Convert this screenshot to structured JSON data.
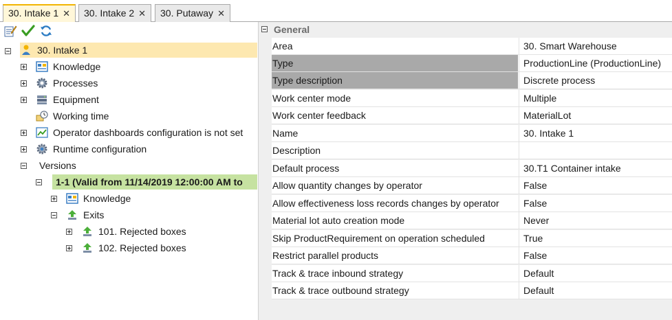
{
  "tabs": [
    {
      "label": "30. Intake 1",
      "close": "✕",
      "active": true
    },
    {
      "label": "30. Intake 2",
      "close": "✕",
      "active": false
    },
    {
      "label": "30. Putaway",
      "close": "✕",
      "active": false
    }
  ],
  "toolbar": {
    "icons": [
      "edit-icon",
      "check-icon",
      "refresh-icon"
    ]
  },
  "tree": {
    "root": "30. Intake 1",
    "knowledge": "Knowledge",
    "processes": "Processes",
    "equipment": "Equipment",
    "working_time": "Working time",
    "operator_dashboards": "Operator dashboards configuration is not set",
    "runtime_configuration": "Runtime configuration",
    "versions": "Versions",
    "version_item": "1-1 (Valid from 11/14/2019 12:00:00 AM to",
    "version_knowledge": "Knowledge",
    "exits": "Exits",
    "exit_1": "101. Rejected boxes",
    "exit_2": "102. Rejected boxes"
  },
  "properties": {
    "section_title": "General",
    "rows": [
      {
        "name": "Area",
        "value": "30. Smart Warehouse"
      },
      {
        "name": "Type",
        "value": "ProductionLine (ProductionLine)"
      },
      {
        "name": "Type description",
        "value": "Discrete process"
      },
      {
        "name": "Work center mode",
        "value": "Multiple"
      },
      {
        "name": "Work center feedback",
        "value": "MaterialLot"
      },
      {
        "name": "Name",
        "value": "30. Intake 1"
      },
      {
        "name": "Description",
        "value": ""
      },
      {
        "name": "Default process",
        "value": "30.T1 Container intake"
      },
      {
        "name": "Allow quantity changes by operator",
        "value": "False"
      },
      {
        "name": "Allow effectiveness loss records changes by operator",
        "value": "False"
      },
      {
        "name": "Material lot auto creation mode",
        "value": "Never"
      },
      {
        "name": "Skip ProductRequirement on operation scheduled",
        "value": "True"
      },
      {
        "name": "Restrict parallel products",
        "value": "False"
      },
      {
        "name": "Track & trace inbound strategy",
        "value": "Default"
      },
      {
        "name": "Track & trace outbound strategy",
        "value": "Default"
      }
    ]
  }
}
